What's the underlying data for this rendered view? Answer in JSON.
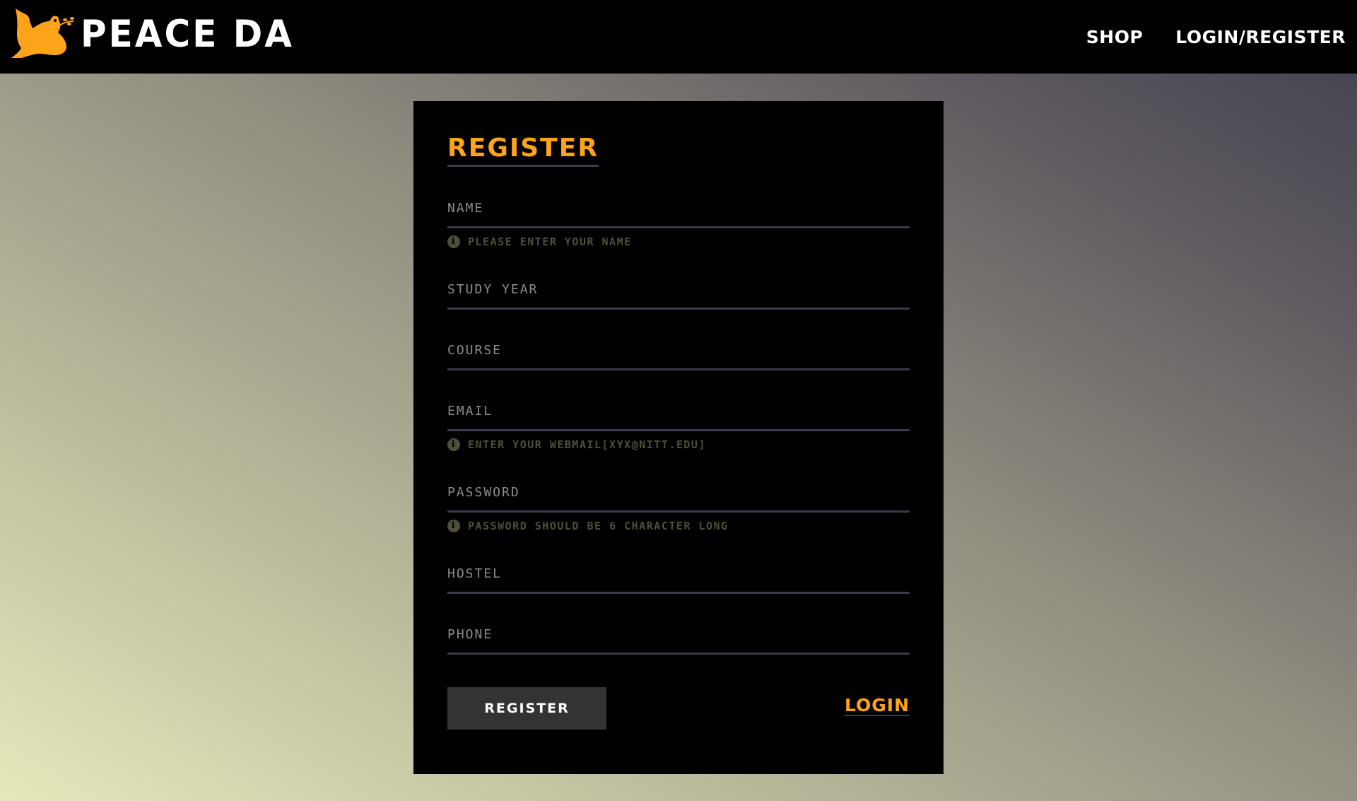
{
  "nav": {
    "brand": "PEACE DA",
    "logo_icon": "dove-with-olive-branch-icon",
    "links": [
      "SHOP",
      "LOGIN/REGISTER"
    ]
  },
  "form": {
    "title": "REGISTER",
    "fields": [
      {
        "label": "NAME",
        "hint": "PLEASE ENTER YOUR NAME"
      },
      {
        "label": "STUDY YEAR"
      },
      {
        "label": "COURSE"
      },
      {
        "label": "EMAIL",
        "hint": "ENTER YOUR WEBMAIL[XYX@NITT.EDU]"
      },
      {
        "label": "PASSWORD",
        "hint": "PASSWORD SHOULD BE 6 CHARACTER LONG"
      },
      {
        "label": "HOSTEL"
      },
      {
        "label": "PHONE"
      }
    ],
    "submit_label": "REGISTER",
    "login_label": "LOGIN"
  },
  "colors": {
    "accent": "#ffa31a",
    "background_top_right": "#413f4d",
    "background_bottom_left": "#e6e8bb",
    "card": "#000000",
    "button": "#333333",
    "underline": "#3b3a4a",
    "hint": "#4f4e3c"
  }
}
